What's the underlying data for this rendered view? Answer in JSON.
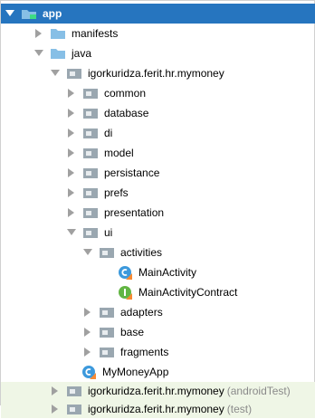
{
  "tree": {
    "rows": [
      {
        "label": "app",
        "expanded": true,
        "icon": "module-folder-icon",
        "selected": true
      },
      {
        "label": "manifests",
        "expanded": false,
        "icon": "folder-icon"
      },
      {
        "label": "java",
        "expanded": true,
        "icon": "folder-icon"
      },
      {
        "label": "igorkuridza.ferit.hr.mymoney",
        "expanded": true,
        "icon": "package-icon"
      },
      {
        "label": "common",
        "expanded": false,
        "icon": "package-icon"
      },
      {
        "label": "database",
        "expanded": false,
        "icon": "package-icon"
      },
      {
        "label": "di",
        "expanded": false,
        "icon": "package-icon"
      },
      {
        "label": "model",
        "expanded": false,
        "icon": "package-icon"
      },
      {
        "label": "persistance",
        "expanded": false,
        "icon": "package-icon"
      },
      {
        "label": "prefs",
        "expanded": false,
        "icon": "package-icon"
      },
      {
        "label": "presentation",
        "expanded": false,
        "icon": "package-icon"
      },
      {
        "label": "ui",
        "expanded": true,
        "icon": "package-icon"
      },
      {
        "label": "activities",
        "expanded": true,
        "icon": "package-icon"
      },
      {
        "label": "MainActivity",
        "icon": "kotlin-class-icon"
      },
      {
        "label": "MainActivityContract",
        "icon": "kotlin-interface-icon"
      },
      {
        "label": "adapters",
        "expanded": false,
        "icon": "package-icon"
      },
      {
        "label": "base",
        "expanded": false,
        "icon": "package-icon"
      },
      {
        "label": "fragments",
        "expanded": false,
        "icon": "package-icon"
      },
      {
        "label": "MyMoneyApp",
        "icon": "kotlin-class-icon"
      },
      {
        "label": "igorkuridza.ferit.hr.mymoney",
        "suffix": "(androidTest)",
        "expanded": false,
        "icon": "package-icon"
      },
      {
        "label": "igorkuridza.ferit.hr.mymoney",
        "suffix": "(test)",
        "expanded": false,
        "icon": "package-icon"
      }
    ]
  },
  "colors": {
    "selection": "#2675bf",
    "test_background": "#eff6e6",
    "folder": "#87bfe6",
    "package": "#9aa7b0",
    "kotlin_class": "#3c99dc",
    "kotlin_interface": "#62b543",
    "suffix_text": "#8a8a8a"
  }
}
